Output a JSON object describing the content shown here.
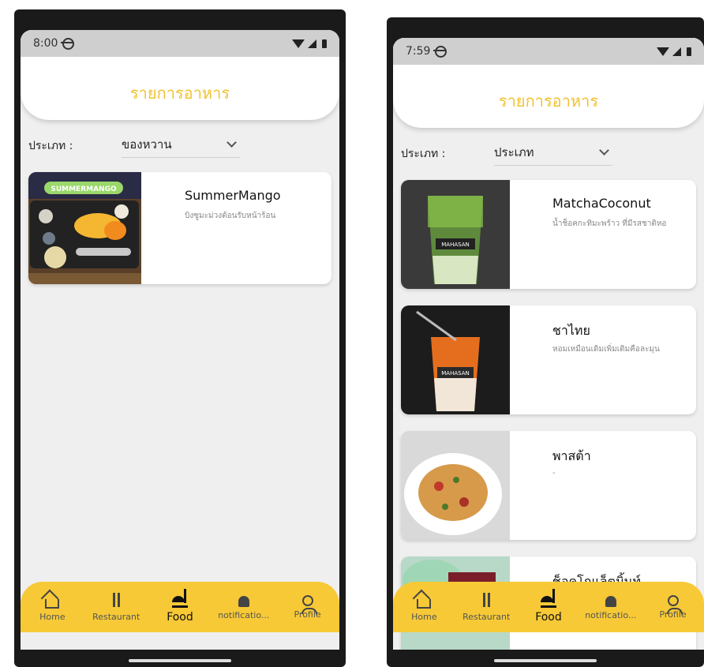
{
  "left": {
    "status": {
      "time": "8:00"
    },
    "header": {
      "title": "รายการอาหาร"
    },
    "filter": {
      "label": "ประเภท :",
      "selected": "ของหวาน"
    },
    "items": [
      {
        "title": "SummerMango",
        "desc": "บิงซูมะม่วงต้อนรับหน้าร้อน",
        "badge": "SUMMERMANGO"
      }
    ]
  },
  "right": {
    "status": {
      "time": "7:59"
    },
    "header": {
      "title": "รายการอาหาร"
    },
    "filter": {
      "label": "ประเภท :",
      "selected": "ประเภท"
    },
    "items": [
      {
        "title": "MatchaCoconut",
        "desc": "น้ำช็อคกะทิมะพร้าว ที่มีรสชาติหอ",
        "badge": "MAHASAN"
      },
      {
        "title": "ชาไทย",
        "desc": "หอมเหมือนเดิมเพิ่มเติมคือละมุน",
        "badge": "MAHASAN"
      },
      {
        "title": "พาสต้า",
        "desc": "-"
      },
      {
        "title": "ช็อคโกแล็ตมิ้นท์",
        "desc": ""
      }
    ]
  },
  "nav": {
    "home": "Home",
    "restaurant": "Restaurant",
    "food": "Food",
    "notification": "notificatio...",
    "profile": "Profile"
  },
  "colors": {
    "accent": "#f7c936",
    "title": "#f2c232"
  }
}
